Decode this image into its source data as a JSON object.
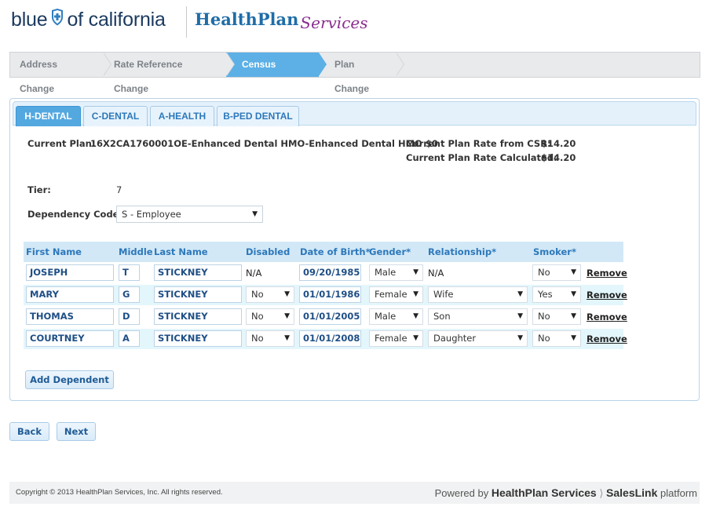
{
  "header": {
    "logo_left": "blue",
    "logo_right": "of california",
    "brand_main": "HealthPlan",
    "brand_sub": "Services"
  },
  "steps": [
    {
      "label": "Address Change",
      "active": false
    },
    {
      "label": "Rate Reference Change",
      "active": false
    },
    {
      "label": "Census Change",
      "active": true
    },
    {
      "label": "Plan Change",
      "active": false
    }
  ],
  "tabs": [
    {
      "label": "H-DENTAL",
      "active": true
    },
    {
      "label": "C-DENTAL",
      "active": false
    },
    {
      "label": "A-HEALTH",
      "active": false
    },
    {
      "label": "B-PED DENTAL",
      "active": false
    }
  ],
  "plan": {
    "current_plan_label": "Current Plan:",
    "current_plan_value": "16X2CA1760001OE-Enhanced Dental HMO-Enhanced Dental HMO $0",
    "rate_csr_label": "Current Plan Rate from CSR:",
    "rate_csr_value": "$14.20",
    "rate_calc_label": "Current Plan Rate Calculated:",
    "rate_calc_value": "$14.20",
    "tier_label": "Tier:",
    "tier_value": "7",
    "dependency_label": "Dependency Code:",
    "dependency_value": "S - Employee"
  },
  "table": {
    "headers": {
      "first": "First Name",
      "middle": "Middle",
      "last": "Last Name",
      "disabled": "Disabled",
      "dob": "Date of Birth*",
      "gender": "Gender*",
      "relationship": "Relationship*",
      "smoker": "Smoker*"
    },
    "rows": [
      {
        "first": "JOSEPH",
        "middle": "T",
        "last": "STICKNEY",
        "disabled": "N/A",
        "dob": "09/20/1985",
        "gender": "Male",
        "relationship": "N/A",
        "smoker": "No",
        "remove": "Remove"
      },
      {
        "first": "MARY",
        "middle": "G",
        "last": "STICKNEY",
        "disabled": "No",
        "dob": "01/01/1986",
        "gender": "Female",
        "relationship": "Wife",
        "smoker": "Yes",
        "remove": "Remove"
      },
      {
        "first": "THOMAS",
        "middle": "D",
        "last": "STICKNEY",
        "disabled": "No",
        "dob": "01/01/2005",
        "gender": "Male",
        "relationship": "Son",
        "smoker": "No",
        "remove": "Remove"
      },
      {
        "first": "COURTNEY",
        "middle": "A",
        "last": "STICKNEY",
        "disabled": "No",
        "dob": "01/01/2008",
        "gender": "Female",
        "relationship": "Daughter",
        "smoker": "No",
        "remove": "Remove"
      }
    ]
  },
  "buttons": {
    "add_dependent": "Add Dependent",
    "back": "Back",
    "next": "Next"
  },
  "footer": {
    "copyright": "Copyright © 2013 HealthPlan Services, Inc. All rights reserved.",
    "powered_by": "Powered by",
    "powered_brand": "HealthPlan Services",
    "powered_product": "SalesLink",
    "powered_suffix": "platform"
  },
  "colors": {
    "accent": "#54a8e0",
    "brand_blue": "#1f6da8",
    "brand_purple": "#8b2f8f",
    "header_row": "#d2e8f7",
    "alt_row": "#e3f6fb"
  }
}
